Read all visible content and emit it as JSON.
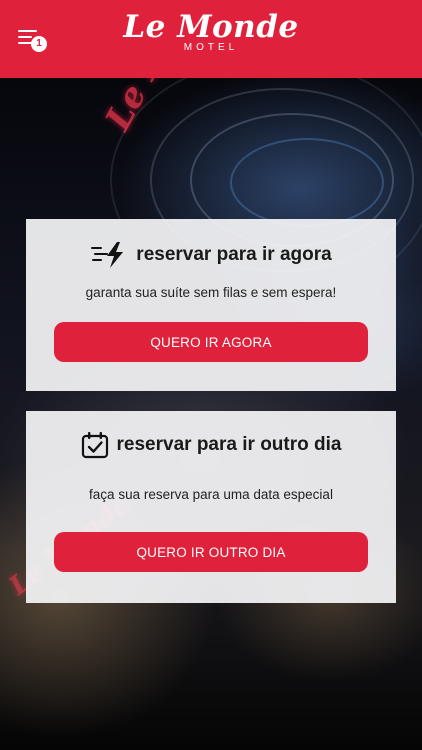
{
  "header": {
    "logo_name": "Le Monde",
    "logo_sub": "MOTEL",
    "menu_badge": "1",
    "menu_icon": "menu-lines-icon",
    "background_color": "#e0213c"
  },
  "background": {
    "neon_sign_text": "Le Monde"
  },
  "cards": {
    "now": {
      "icon": "fast-bolt-icon",
      "title": "reservar para ir agora",
      "subtitle": "garanta sua suíte sem filas e sem espera!",
      "button_label": "QUERO IR AGORA"
    },
    "later": {
      "icon": "calendar-check-icon",
      "title": "reservar para ir outro dia",
      "subtitle": "faça sua reserva para uma data especial",
      "button_label": "QUERO IR OUTRO DIA"
    }
  },
  "colors": {
    "accent": "#e0213c",
    "card_bg": "#f4f4f6"
  }
}
